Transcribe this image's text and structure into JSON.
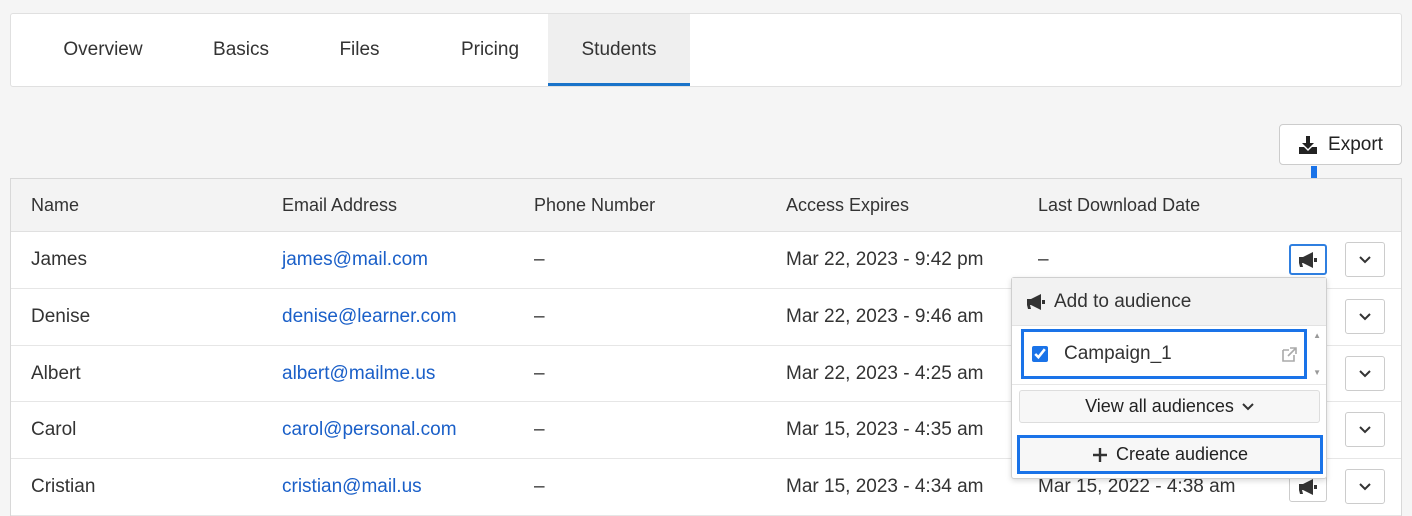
{
  "tabs": [
    {
      "label": "Overview"
    },
    {
      "label": "Basics"
    },
    {
      "label": "Files"
    },
    {
      "label": "Pricing"
    },
    {
      "label": "Students",
      "active": true
    }
  ],
  "export": {
    "label": "Export",
    "icon": "download-icon"
  },
  "table": {
    "headers": [
      "Name",
      "Email Address",
      "Phone Number",
      "Access Expires",
      "Last Download Date"
    ],
    "rows": [
      {
        "name": "James",
        "email": "james@mail.com",
        "phone": "–",
        "expires": "Mar 22, 2023 - 9:42 pm",
        "last_download": "–"
      },
      {
        "name": "Denise",
        "email": "denise@learner.com",
        "phone": "–",
        "expires": "Mar 22, 2023 - 9:46 am",
        "last_download": ""
      },
      {
        "name": "Albert",
        "email": "albert@mailme.us",
        "phone": "–",
        "expires": "Mar 22, 2023 - 4:25 am",
        "last_download": ""
      },
      {
        "name": "Carol",
        "email": "carol@personal.com",
        "phone": "–",
        "expires": "Mar 15, 2023 - 4:35 am",
        "last_download": ""
      },
      {
        "name": "Cristian",
        "email": "cristian@mail.us",
        "phone": "–",
        "expires": "Mar 15, 2023 - 4:34 am",
        "last_download": "Mar 15, 2022 - 4:38 am"
      }
    ]
  },
  "audience_menu": {
    "title": "Add to audience",
    "items": [
      {
        "label": "Campaign_1",
        "checked": true
      }
    ],
    "view_all_label": "View all audiences",
    "create_label": "Create audience"
  },
  "colors": {
    "accent": "#1a73e8",
    "link": "#1a5fc8",
    "tab_underline": "#1a73c9"
  }
}
